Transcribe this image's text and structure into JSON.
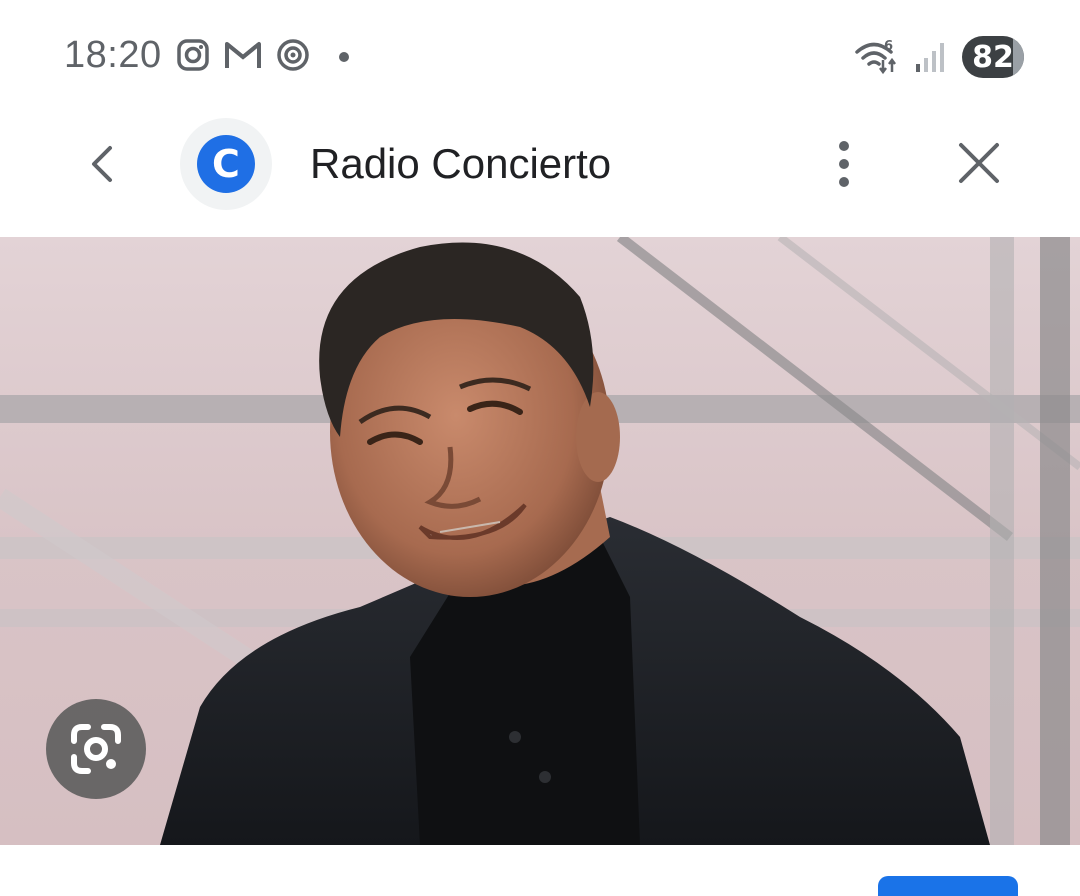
{
  "status_bar": {
    "time": "18:20",
    "notification_icons": [
      "instagram-icon",
      "gmail-icon",
      "threads-icon",
      "more-dot-icon"
    ],
    "wifi_icon": "wifi-6-icon",
    "signal_icon": "signal-weak-icon",
    "battery_level": "82",
    "battery_fraction": 0.82
  },
  "header": {
    "back_icon": "chevron-left-icon",
    "favicon_letter": "C",
    "favicon_color": "#1f6fe5",
    "site_name": "Radio Concierto",
    "more_icon": "more-vert-icon",
    "close_icon": "close-icon"
  },
  "content": {
    "lens_icon": "google-lens-icon",
    "accent_color": "#1a73e8"
  }
}
